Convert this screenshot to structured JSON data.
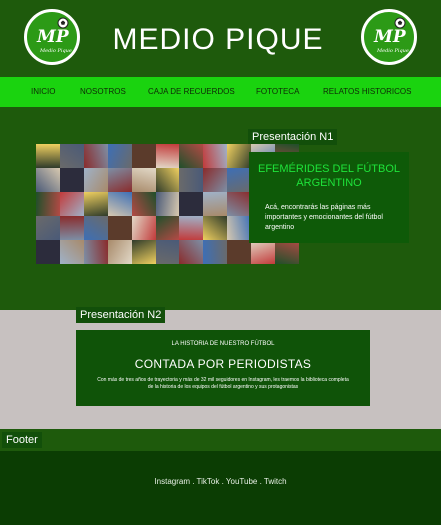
{
  "header": {
    "title": "MEDIO PIQUE",
    "logo": {
      "initials": "MP",
      "subtitle": "Medio Pique",
      "icon": "soccer-ball-icon"
    }
  },
  "nav": {
    "items": [
      {
        "label": "INICIO"
      },
      {
        "label": "NOSOTROS"
      },
      {
        "label": "CAJA DE RECUERDOS"
      },
      {
        "label": "FOTOTECA"
      },
      {
        "label": "RELATOS HISTORICOS"
      }
    ]
  },
  "presentacion1": {
    "tag": "Presentación N1",
    "card_title": "EFEMÉRIDES DEL FÚTBOL ARGENTINO",
    "card_text": "Acá, encontrarás las páginas más importantes y emocionantes del fútbol argentino"
  },
  "presentacion2": {
    "tag": "Presentación N2",
    "kicker": "LA HISTORIA DE NUESTRO FÚTBOL",
    "title": "CONTADA POR PERIODISTAS",
    "text": "Con más de tres años de trayectoria y más de 32 mil seguidores en Instagram, les traemos la biblioteca completa de la historia de los equipos del fútbol argentino y sus protagonistas"
  },
  "footer": {
    "tag": "Footer",
    "links": [
      "Instagram",
      "TikTok",
      "YouTube",
      "Twitch"
    ],
    "separator": " . "
  },
  "colors": {
    "background": "#1e5a0c",
    "nav": "#1ad30f",
    "card": "#0e5a08",
    "section2": "#c7c1c0",
    "footer": "#0b3d03",
    "accent_title": "#1ee33a"
  }
}
